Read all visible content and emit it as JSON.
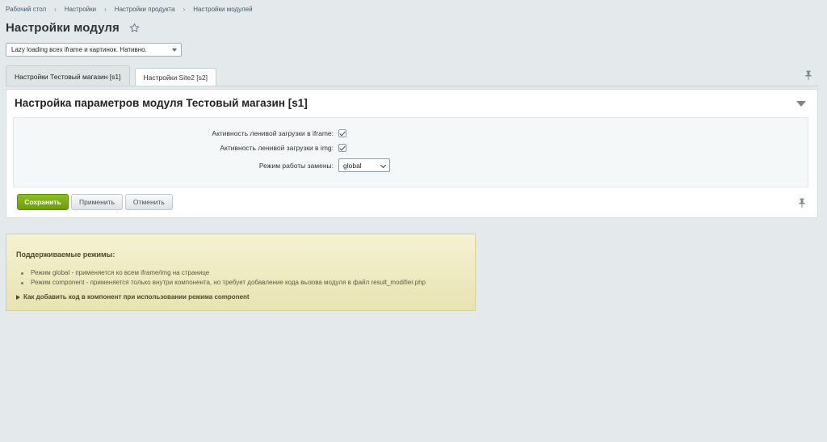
{
  "breadcrumb": [
    "Рабочий стол",
    "Настройки",
    "Настройки продукта",
    "Настройки модулей"
  ],
  "page_title": "Настройки модуля",
  "module_select": {
    "value": "Lazy loading всех iframe и картинок. Нативно."
  },
  "tabs": [
    {
      "label": "Настройки Тестовый магазин [s1]",
      "active": true
    },
    {
      "label": "Настройки Site2 [s2]",
      "active": false
    }
  ],
  "panel": {
    "title": "Настройка параметров модуля Тестовый магазин [s1]",
    "fields": {
      "iframe_label": "Активность ленивой загрузки в iframe:",
      "iframe_checked": true,
      "img_label": "Активность ленивой загрузки в img:",
      "img_checked": true,
      "mode_label": "Режим работы замены:",
      "mode_value": "global"
    },
    "buttons": {
      "save": "Сохранить",
      "apply": "Применить",
      "cancel": "Отменить"
    }
  },
  "info": {
    "title": "Поддерживаемые режимы:",
    "items": [
      "Режим global - применяется ко всем iframe/img на странице",
      "Режим component - применяется только внутри компонента, но требует добавление кода вызова модуля в файл result_modifier.php"
    ],
    "toggle": "Как добавить код в компонент при использовании режима component"
  },
  "colors": {
    "save_button": "#7aad16",
    "info_bg": "#efebc3",
    "page_bg": "#e4e9ec"
  }
}
